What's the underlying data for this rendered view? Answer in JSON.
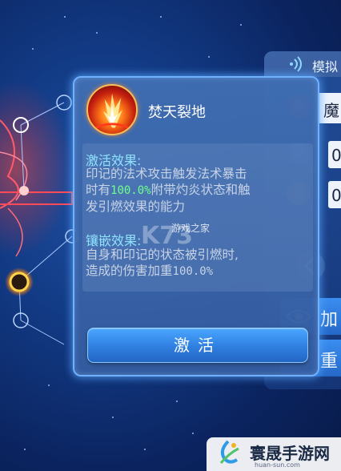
{
  "popup": {
    "skill_icon": "flame-burst-icon",
    "skill_name": "焚天裂地",
    "activation": {
      "title": "激活效果:",
      "lines": [
        "印记的法术攻击触发法术暴击",
        "时有",
        "100.0%",
        "附带灼炎状态和触",
        "发引燃效果的能力"
      ]
    },
    "inlay": {
      "title": "镶嵌效果:",
      "line1": "自身和印记的状态被引燃时,",
      "line2_prefix": "造成的伤害加重",
      "line2_value": "100.0%"
    },
    "activate_label": "激活"
  },
  "side_panel": {
    "title": "模拟",
    "title_icon": "signal-waves-icon",
    "row1": "魔",
    "row2": "0",
    "row3": "0",
    "btn1": "加",
    "btn2": "重",
    "eye_icon": "eye-icon",
    "arrow_icon": "chevron-left-icon"
  },
  "watermark": {
    "k73_sub": "游戏之家",
    "brand_cn": "寰晟手游网",
    "brand_url": "huan-sun.com"
  },
  "colors": {
    "accent_blue": "#4aa6ff",
    "highlight_green": "#6fff8c",
    "section_cyan": "#8fe3ff",
    "popup_border": "#6fb0ff"
  }
}
